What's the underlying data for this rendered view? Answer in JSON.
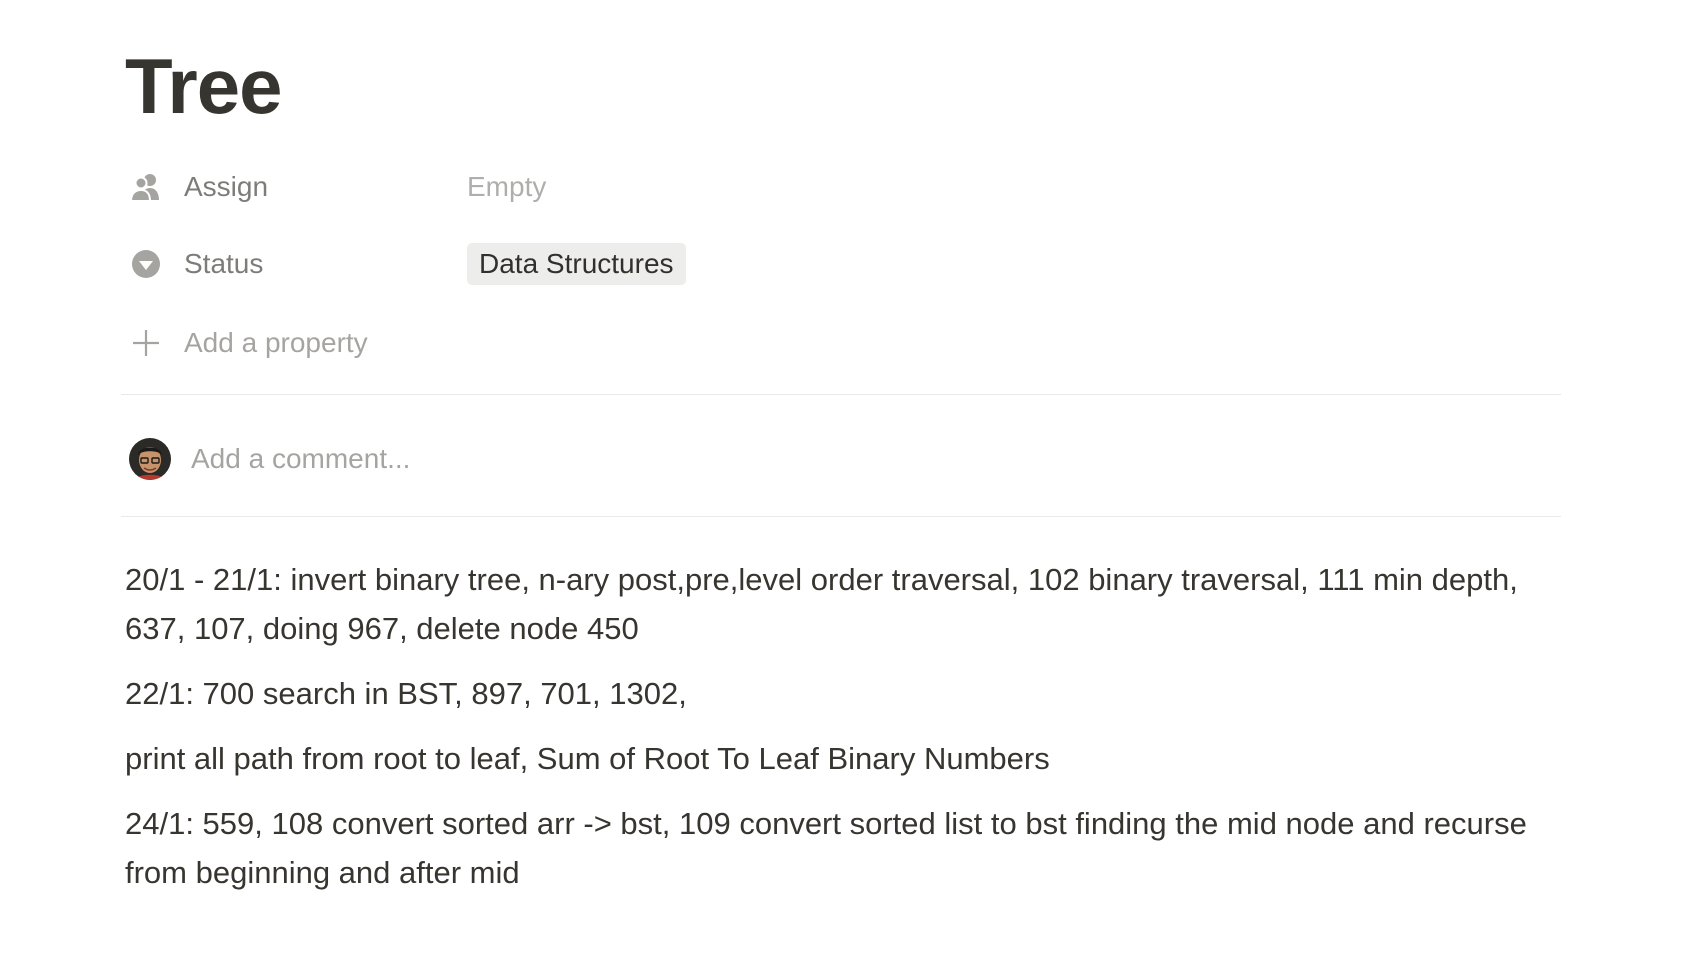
{
  "page": {
    "title": "Tree"
  },
  "properties": [
    {
      "name": "Assign",
      "icon": "people-icon",
      "value": "Empty"
    },
    {
      "name": "Status",
      "icon": "chevron-circle-down-icon",
      "value": "Data Structures"
    }
  ],
  "add_property_label": "Add a property",
  "comment": {
    "placeholder": "Add a comment..."
  },
  "blocks": [
    "20/1 - 21/1: invert binary tree, n-ary post,pre,level order traversal, 102 binary traversal, 111 min depth, 637, 107, doing 967, delete node 450",
    "22/1: 700 search in BST, 897, 701, 1302,",
    "print all path from root to leaf, Sum of Root To Leaf Binary Numbers",
    "24/1: 559, 108 convert sorted arr -> bst, 109 convert sorted list to bst finding the mid node and recurse from beginning and after mid"
  ],
  "colors": {
    "text": "#37352f",
    "muted": "#9b9a97",
    "pill_bg": "#ededeb",
    "divider": "#e9e9e7"
  }
}
